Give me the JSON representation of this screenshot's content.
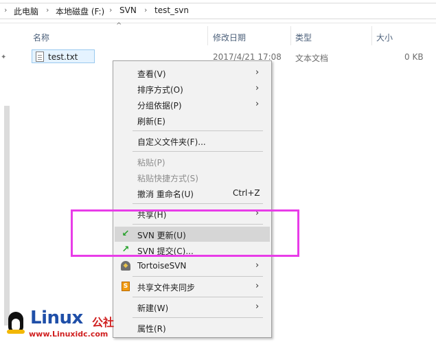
{
  "breadcrumb": {
    "items": [
      "此电脑",
      "本地磁盘 (F:)",
      "SVN",
      "test_svn"
    ],
    "separator": "›"
  },
  "columns": {
    "name": "名称",
    "modified": "修改日期",
    "type": "类型",
    "size": "大小"
  },
  "file": {
    "name": "test.txt",
    "modified": "2017/4/21 17:08",
    "type": "文本文档",
    "size": "0 KB"
  },
  "context_menu": {
    "items": [
      {
        "label": "查看(V)",
        "submenu": true
      },
      {
        "label": "排序方式(O)",
        "submenu": true
      },
      {
        "label": "分组依据(P)",
        "submenu": true
      },
      {
        "label": "刷新(E)"
      },
      {
        "label": "自定义文件夹(F)..."
      },
      {
        "label": "粘贴(P)",
        "disabled": true
      },
      {
        "label": "粘贴快捷方式(S)",
        "disabled": true
      },
      {
        "label": "撤消 重命名(U)",
        "shortcut": "Ctrl+Z"
      },
      {
        "label": "共享(H)",
        "submenu": true
      },
      {
        "label": "SVN 更新(U)",
        "icon": "svn-update-icon"
      },
      {
        "label": "SVN 提交(C)...",
        "icon": "svn-commit-icon"
      },
      {
        "label": "TortoiseSVN",
        "icon": "tortoisesvn-icon",
        "submenu": true
      },
      {
        "label": "共享文件夹同步",
        "icon": "shared-folder-sync-icon",
        "submenu": true
      },
      {
        "label": "新建(W)",
        "submenu": true
      },
      {
        "label": "属性(R)"
      }
    ]
  },
  "watermark": {
    "brand": "Linux",
    "brand_cn": "公社",
    "url": "www.Linuxidc.com"
  },
  "colors": {
    "highlight_box": "#e83ce8",
    "hover": "#d6d6d6",
    "menu_bg": "#f2f2f2"
  }
}
